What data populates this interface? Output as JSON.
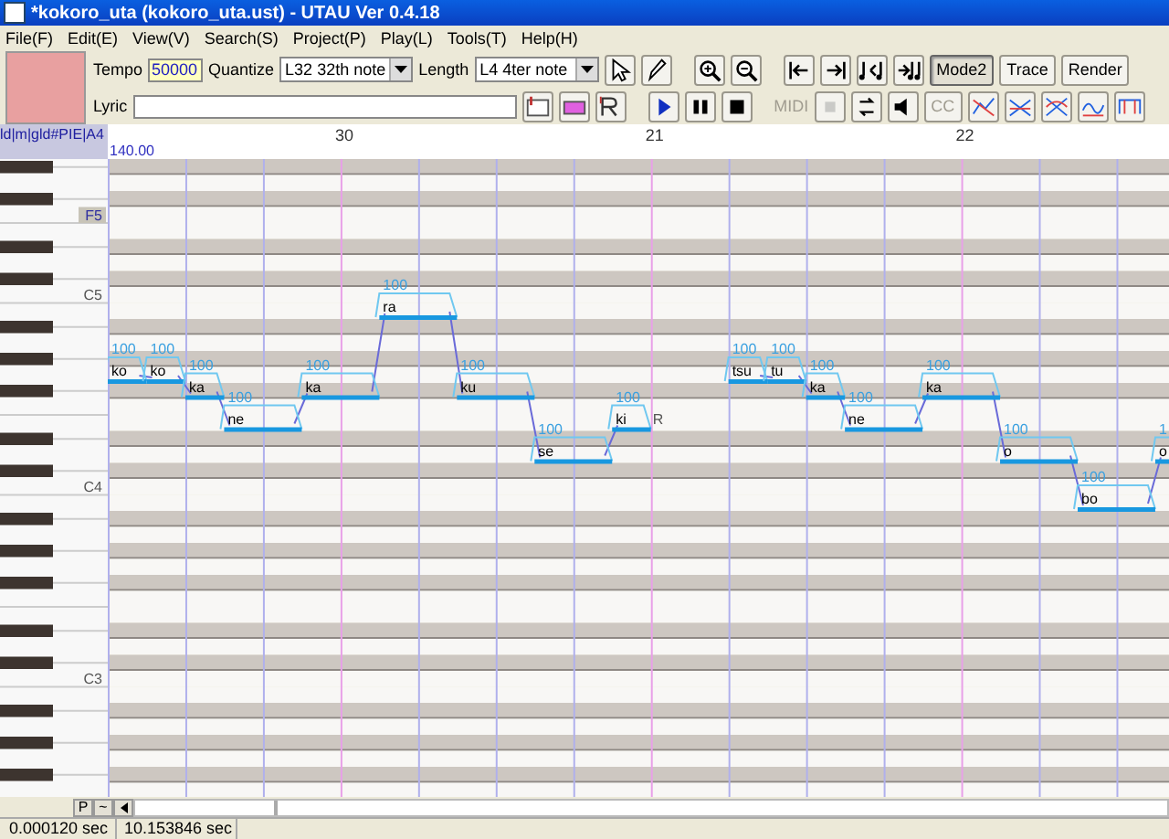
{
  "window": {
    "title": "*kokoro_uta (kokoro_uta.ust) - UTAU Ver 0.4.18"
  },
  "menu": [
    "File(F)",
    "Edit(E)",
    "View(V)",
    "Search(S)",
    "Project(P)",
    "Play(L)",
    "Tools(T)",
    "Help(H)"
  ],
  "toolbar": {
    "row1": [
      {
        "kind": "label",
        "text": "Tempo",
        "disabled": false
      },
      {
        "kind": "field",
        "value": "50000"
      },
      {
        "kind": "label",
        "text": "Quantize",
        "disabled": false
      },
      {
        "kind": "select",
        "value": "L32 32th note"
      },
      {
        "kind": "label",
        "text": "Length",
        "disabled": false
      },
      {
        "kind": "select",
        "value": "L4  4ter note"
      },
      {
        "kind": "icon",
        "pressed": false,
        "disabled": false
      },
      {
        "kind": "icon",
        "pressed": false,
        "disabled": false
      },
      {
        "kind": "gap"
      },
      {
        "kind": "icon",
        "pressed": false,
        "disabled": false
      },
      {
        "kind": "icon",
        "pressed": false,
        "disabled": false
      },
      {
        "kind": "gap"
      },
      {
        "kind": "icon",
        "pressed": false,
        "disabled": false
      },
      {
        "kind": "icon",
        "pressed": false,
        "disabled": false
      },
      {
        "kind": "icon",
        "pressed": false,
        "disabled": false
      },
      {
        "kind": "icon",
        "pressed": false,
        "disabled": false
      },
      {
        "kind": "text",
        "text": "Mode2",
        "pressed": true,
        "disabled": false
      },
      {
        "kind": "text",
        "text": "Trace",
        "pressed": false,
        "disabled": false
      },
      {
        "kind": "text",
        "text": "Render",
        "pressed": false,
        "disabled": false
      }
    ],
    "row2": [
      {
        "kind": "label",
        "text": "Lyric",
        "disabled": false
      },
      {
        "kind": "wide-field"
      },
      {
        "kind": "icon",
        "pressed": false,
        "disabled": false
      },
      {
        "kind": "icon",
        "pressed": false,
        "disabled": false
      },
      {
        "kind": "icon",
        "pressed": false,
        "disabled": false
      },
      {
        "kind": "gap"
      },
      {
        "kind": "icon",
        "pressed": false,
        "disabled": false
      },
      {
        "kind": "icon",
        "pressed": false,
        "disabled": false
      },
      {
        "kind": "icon",
        "pressed": false,
        "disabled": false
      },
      {
        "kind": "gap"
      },
      {
        "kind": "label",
        "text": "MIDI",
        "disabled": true
      },
      {
        "kind": "icon",
        "pressed": false,
        "disabled": true
      },
      {
        "kind": "icon",
        "pressed": false,
        "disabled": false
      },
      {
        "kind": "icon",
        "pressed": false,
        "disabled": false
      },
      {
        "kind": "text",
        "text": "CC",
        "pressed": false,
        "disabled": true
      },
      {
        "kind": "icon",
        "pressed": false,
        "disabled": false
      },
      {
        "kind": "icon",
        "pressed": false,
        "disabled": false
      },
      {
        "kind": "icon",
        "pressed": false,
        "disabled": false
      },
      {
        "kind": "icon",
        "pressed": false,
        "disabled": false
      },
      {
        "kind": "icon",
        "pressed": false,
        "disabled": false
      }
    ]
  },
  "track_header": {
    "label": "ld|m|gld#PIE|A4",
    "tempo": "140.00"
  },
  "ruler": [
    "30",
    "21",
    "22"
  ],
  "piano_labels": [
    {
      "text": "F5",
      "highlighted": true
    },
    {
      "text": "C5",
      "highlighted": false
    },
    {
      "text": "C4",
      "highlighted": false
    },
    {
      "text": "C3",
      "highlighted": false
    }
  ],
  "notes": [
    {
      "kind": "note",
      "lyric": "ko",
      "intensity": "100"
    },
    {
      "kind": "note",
      "lyric": "ko",
      "intensity": "100"
    },
    {
      "kind": "note",
      "lyric": "ka",
      "intensity": "100"
    },
    {
      "kind": "note",
      "lyric": "ne",
      "intensity": "100"
    },
    {
      "kind": "note",
      "lyric": "ka",
      "intensity": "100"
    },
    {
      "kind": "note",
      "lyric": "ra",
      "intensity": "100"
    },
    {
      "kind": "note",
      "lyric": "ku",
      "intensity": "100"
    },
    {
      "kind": "note",
      "lyric": "se",
      "intensity": "100"
    },
    {
      "kind": "note",
      "lyric": "ki",
      "intensity": "100"
    },
    {
      "kind": "rest",
      "lyric": "R"
    },
    {
      "kind": "note",
      "lyric": "tsu",
      "intensity": "100"
    },
    {
      "kind": "note",
      "lyric": "tu",
      "intensity": "100"
    },
    {
      "kind": "note",
      "lyric": "ka",
      "intensity": "100"
    },
    {
      "kind": "note",
      "lyric": "ne",
      "intensity": "100"
    },
    {
      "kind": "note",
      "lyric": "ka",
      "intensity": "100"
    },
    {
      "kind": "note",
      "lyric": "o",
      "intensity": "100"
    },
    {
      "kind": "note",
      "lyric": "bo",
      "intensity": "100"
    },
    {
      "kind": "note",
      "lyric": "o",
      "intensity": "1"
    }
  ],
  "bottom_buttons": [
    "P",
    "~"
  ],
  "status_bar": [
    "0.000120 sec",
    "10.153846 sec"
  ]
}
